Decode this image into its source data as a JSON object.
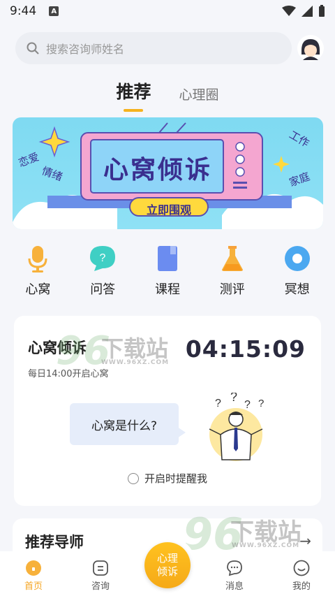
{
  "status": {
    "time": "9:44",
    "badge": "A"
  },
  "search": {
    "placeholder": "搜索咨询师姓名"
  },
  "tabs": [
    {
      "label": "推荐",
      "active": true
    },
    {
      "label": "心理圈",
      "active": false
    }
  ],
  "banner": {
    "title": "心窝倾诉",
    "button": "立即围观",
    "tags": [
      "恋爱",
      "情绪",
      "工作",
      "家庭"
    ]
  },
  "features": [
    {
      "label": "心窝",
      "icon": "microphone-icon"
    },
    {
      "label": "问答",
      "icon": "question-bubble-icon"
    },
    {
      "label": "课程",
      "icon": "book-icon"
    },
    {
      "label": "测评",
      "icon": "flask-icon"
    },
    {
      "label": "冥想",
      "icon": "meditation-circle-icon"
    }
  ],
  "session_card": {
    "title": "心窝倾诉",
    "subtitle": "每日14:00开启心窝",
    "countdown": "04:15:09",
    "bubble": "心窝是什么?",
    "remind": "开启时提醒我"
  },
  "mentors": {
    "title": "推荐导师"
  },
  "watermark": {
    "text": "下载站",
    "url": "WWW.96XZ.COM"
  },
  "bottom_nav": [
    {
      "label": "首页",
      "icon": "home-icon",
      "active": true
    },
    {
      "label": "咨询",
      "icon": "consult-icon",
      "active": false
    },
    {
      "label": "消息",
      "icon": "message-icon",
      "active": false
    },
    {
      "label": "我的",
      "icon": "profile-icon",
      "active": false
    }
  ],
  "fab": {
    "line1": "心理",
    "line2": "倾诉"
  },
  "colors": {
    "accent": "#f5b21f",
    "banner_bg": "#8fe1f5",
    "tv_pink": "#f4a6d0"
  }
}
